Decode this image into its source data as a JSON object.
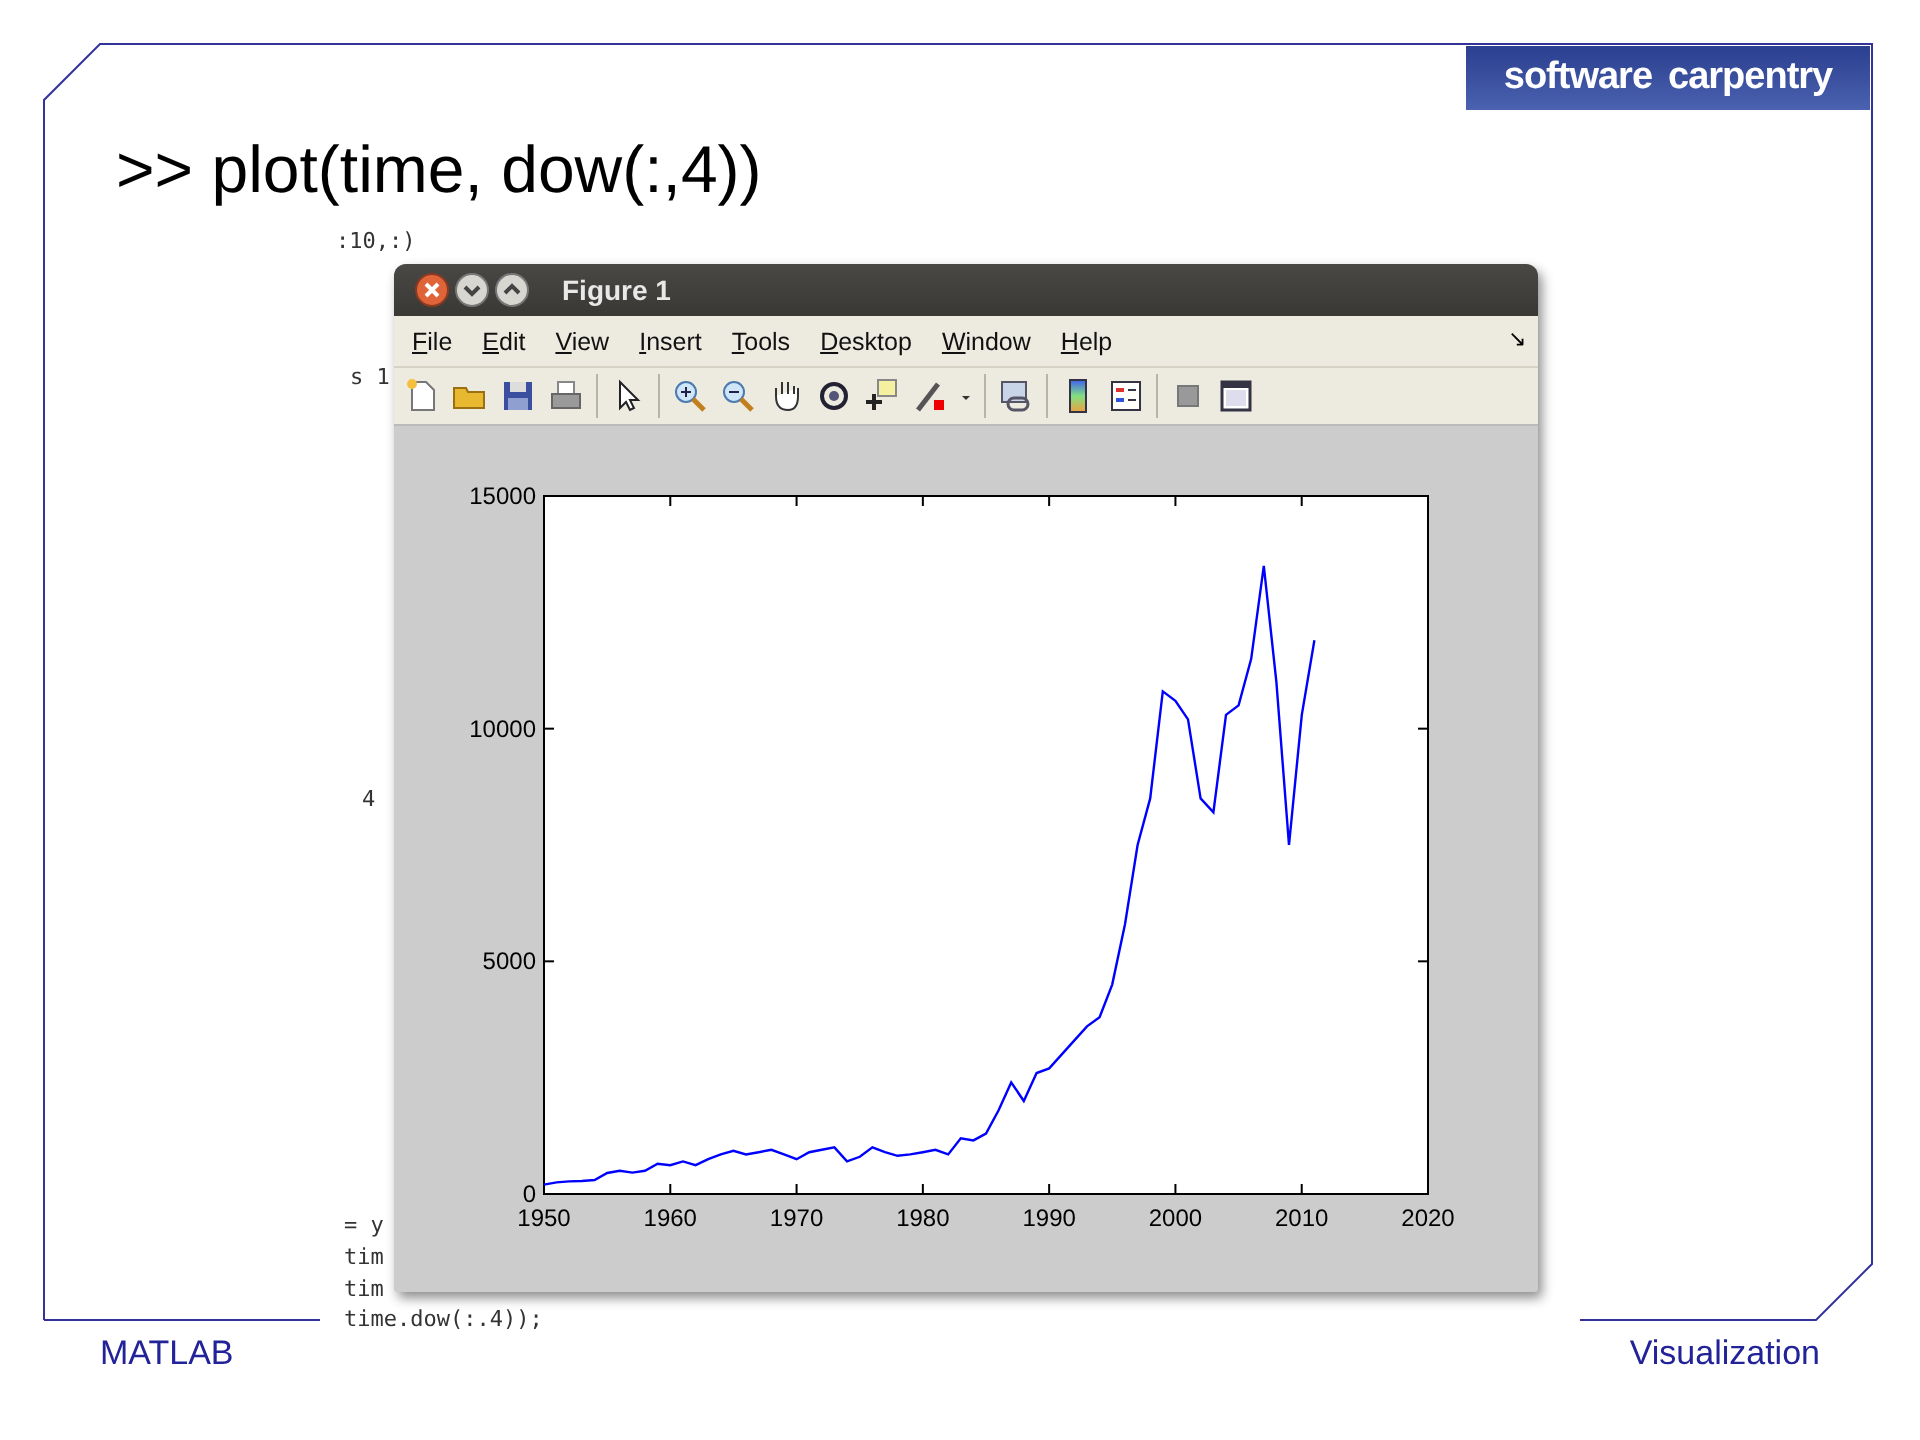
{
  "slide": {
    "title": ">> plot(time, dow(:,4))",
    "logo_words": [
      "software",
      "carpentry"
    ],
    "footer_left": "MATLAB",
    "footer_right": "Visualization"
  },
  "console_lines": [
    ":10,:)",
    "s 1",
    "4",
    "= y",
    "tim",
    "tim",
    "time.dow(:.4));"
  ],
  "figure_window": {
    "title": "Figure 1",
    "menu": [
      {
        "label": "File"
      },
      {
        "label": "Edit"
      },
      {
        "label": "View"
      },
      {
        "label": "Insert"
      },
      {
        "label": "Tools"
      },
      {
        "label": "Desktop"
      },
      {
        "label": "Window"
      },
      {
        "label": "Help"
      }
    ],
    "dock_arrow": "↘",
    "chart_data": {
      "type": "line",
      "x": [
        1950,
        1951,
        1952,
        1953,
        1954,
        1955,
        1956,
        1957,
        1958,
        1959,
        1960,
        1961,
        1962,
        1963,
        1964,
        1965,
        1966,
        1967,
        1968,
        1969,
        1970,
        1971,
        1972,
        1973,
        1974,
        1975,
        1976,
        1977,
        1978,
        1979,
        1980,
        1981,
        1982,
        1983,
        1984,
        1985,
        1986,
        1987,
        1988,
        1989,
        1990,
        1991,
        1992,
        1993,
        1994,
        1995,
        1996,
        1997,
        1998,
        1999,
        2000,
        2001,
        2002,
        2003,
        2004,
        2005,
        2006,
        2007,
        2008,
        2009,
        2010,
        2011
      ],
      "series": [
        {
          "color": "#0000ff",
          "values": [
            200,
            250,
            270,
            280,
            300,
            450,
            500,
            460,
            500,
            650,
            620,
            700,
            620,
            750,
            850,
            930,
            850,
            900,
            950,
            850,
            750,
            900,
            950,
            1000,
            700,
            800,
            1000,
            900,
            820,
            850,
            900,
            950,
            850,
            1200,
            1150,
            1300,
            1800,
            2400,
            2000,
            2600,
            2700,
            3000,
            3300,
            3600,
            3800,
            4500,
            5800,
            7500,
            8500,
            10800,
            10600,
            10200,
            8500,
            8200,
            10300,
            10500,
            11500,
            13500,
            11000,
            7500,
            10300,
            11900
          ]
        }
      ],
      "xlim": [
        1950,
        2020
      ],
      "ylim": [
        0,
        15000
      ],
      "xticks": [
        1950,
        1960,
        1970,
        1980,
        1990,
        2000,
        2010,
        2020
      ],
      "yticks": [
        0,
        5000,
        10000,
        15000
      ]
    }
  }
}
